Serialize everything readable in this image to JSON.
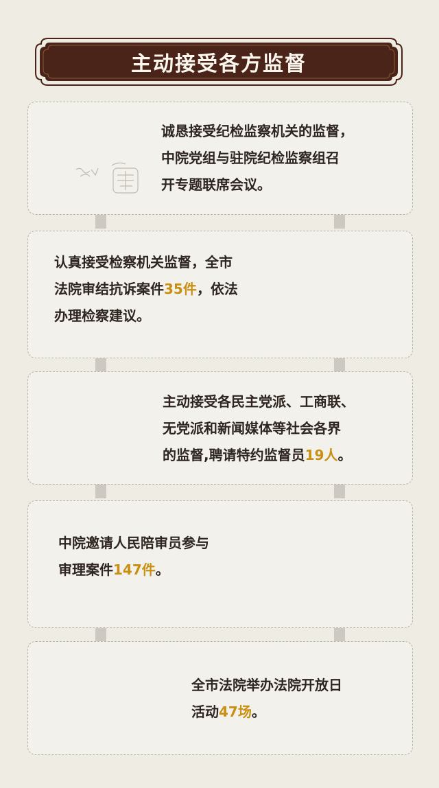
{
  "header": {
    "title": "主动接受各方监督"
  },
  "cards": [
    {
      "lines": [
        "诚恳接受纪检监察机关的监督，",
        "中院党组与驻院纪检监察组召",
        "开专题联席会议。"
      ]
    },
    {
      "lines": [
        "认真接受检察机关监督，全市",
        "法院审结抗诉案件",
        "35件",
        "，依法",
        "办理检察建议。"
      ]
    },
    {
      "lines": [
        "主动接受各民主党派、工商联、",
        "无党派和新闻媒体等社会各界",
        "的监督,聘请特约监督员",
        "19人",
        "。"
      ]
    },
    {
      "lines": [
        "中院邀请人民陪审员参与",
        "审理案件",
        "147件",
        "。"
      ]
    },
    {
      "lines": [
        "全市法院举办法院开放日",
        "活动",
        "47场",
        "。"
      ]
    }
  ],
  "colors": {
    "frame": "#4a2418",
    "highlight": "#c88f12",
    "card_border": "#b9b2a8"
  },
  "icons": {
    "decoration": "ink-seal-icon"
  }
}
